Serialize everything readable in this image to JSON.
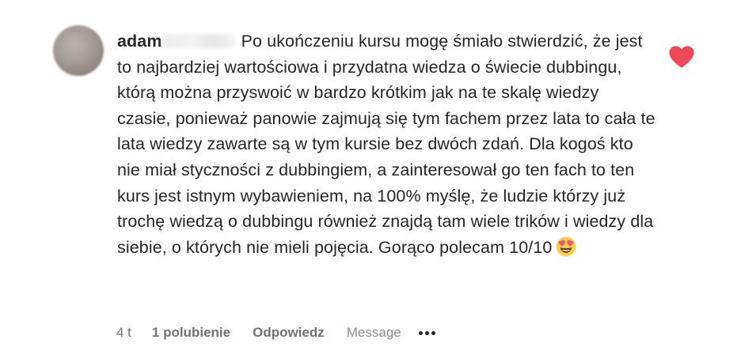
{
  "comment": {
    "username": "adam",
    "text": "Po ukończeniu kursu mogę śmiało stwierdzić, że jest to najbardziej wartościowa i przydatna wiedza o świecie dubbingu, którą można przyswoić w bardzo krótkim jak na te skalę wiedzy czasie, ponieważ panowie zajmują się tym fachem przez lata to cała te lata wiedzy zawarte są w tym kursie bez dwóch zdań. Dla kogoś kto nie miał styczności z dubbingiem, a zainteresował go ten fach to ten kurs jest istnym wybawieniem, na 100% myślę, że ludzie którzy już trochę wiedzą o dubbingu również znajdą tam wiele trików i wiedzy dla siebie, o których nie mieli pojęcia. Gorąco polecam 10/10",
    "emoji": "smiling-face-with-heart-eyes",
    "liked": true,
    "like_color": "#ed4956"
  },
  "actions": {
    "time": "4 t",
    "likes": "1 polubienie",
    "reply": "Odpowiedz",
    "message": "Message",
    "more_icon": "more-horizontal-icon"
  }
}
